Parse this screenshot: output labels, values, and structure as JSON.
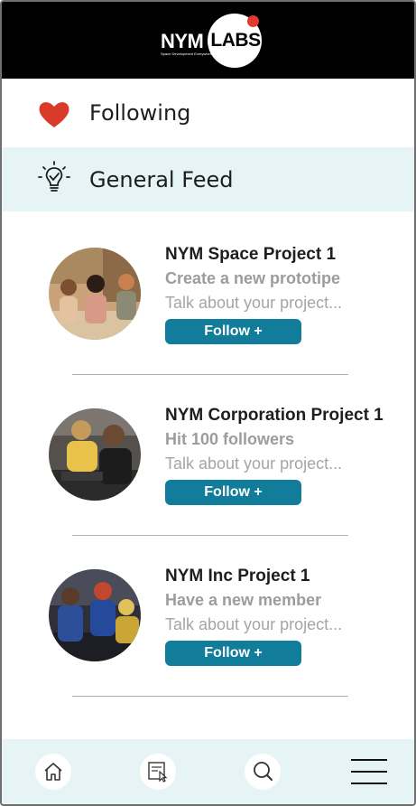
{
  "header": {
    "logo_left": "NYM",
    "logo_right": "LABS",
    "logo_tagline": "Space Development Everywhere",
    "background": "#000000",
    "accent_dot": "#e1392a"
  },
  "menu": {
    "following": {
      "label": "Following",
      "icon": "heart-icon",
      "color": "#d93a2a"
    },
    "general_feed": {
      "label": "General Feed",
      "icon": "lightbulb-icon",
      "background": "#e6f4f5"
    }
  },
  "feed": [
    {
      "title": "NYM Space Project 1",
      "subtitle": "Create a new prototipe",
      "description": "Talk about your project...",
      "button": "Follow +"
    },
    {
      "title": "NYM Corporation Project 1",
      "subtitle": "Hit 100 followers",
      "description": "Talk about your project...",
      "button": "Follow +"
    },
    {
      "title": "NYM Inc Project 1",
      "subtitle": "Have a new member",
      "description": "Talk about your project...",
      "button": "Follow +"
    }
  ],
  "bottom_nav": {
    "items": [
      "home-icon",
      "projects-icon",
      "search-icon",
      "menu-icon"
    ],
    "background": "#e6f4f5"
  },
  "colors": {
    "button": "#117d9b"
  }
}
